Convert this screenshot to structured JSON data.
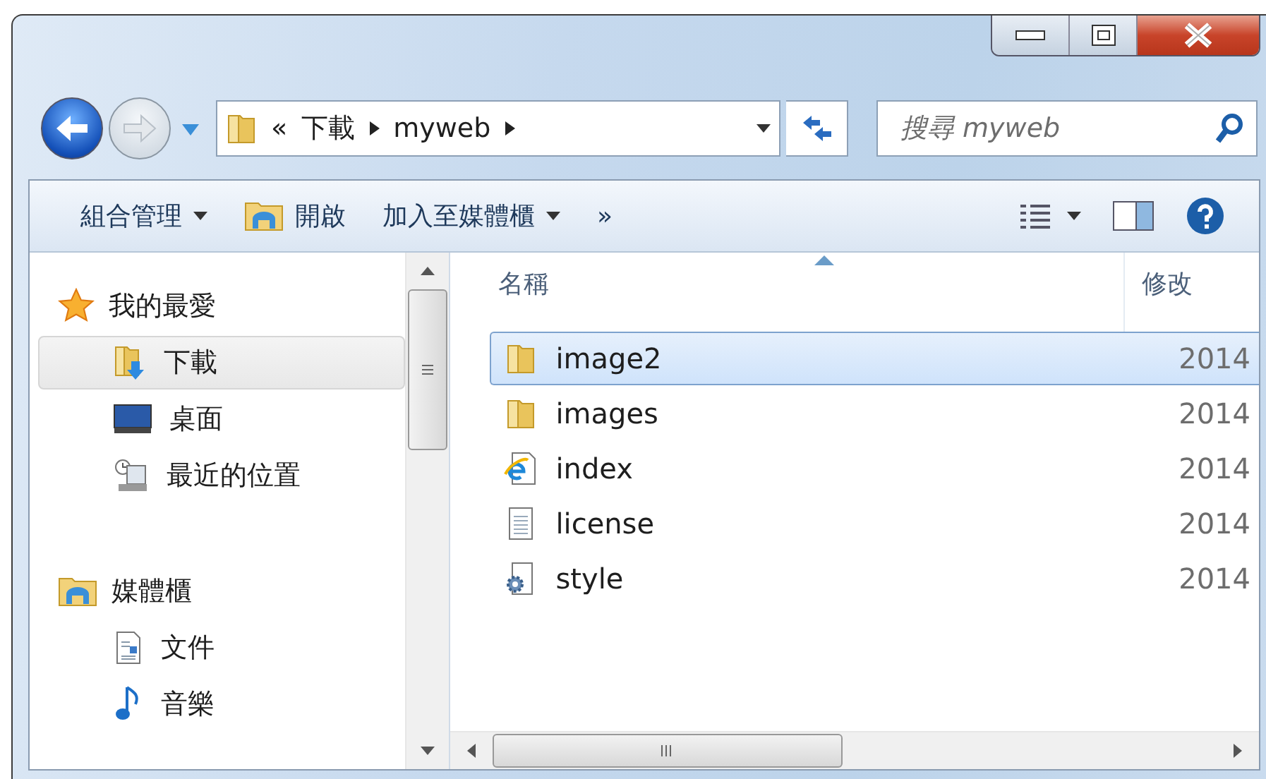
{
  "address_bar": {
    "overflow": "«",
    "crumbs": [
      "下載",
      "myweb"
    ]
  },
  "search": {
    "placeholder": "搜尋 myweb"
  },
  "toolbar": {
    "items": [
      {
        "kind": "menu",
        "label": "組合管理"
      },
      {
        "kind": "open",
        "label": "開啟"
      },
      {
        "kind": "menu",
        "label": "加入至媒體櫃"
      },
      {
        "kind": "more",
        "label": "»"
      }
    ]
  },
  "sidebar": {
    "groups": [
      {
        "label": "我的最愛",
        "children": [
          {
            "label": "下載",
            "selected": true
          },
          {
            "label": "桌面",
            "selected": false
          },
          {
            "label": "最近的位置",
            "selected": false
          }
        ]
      },
      {
        "label": "媒體櫃",
        "children": [
          {
            "label": "文件",
            "selected": false
          },
          {
            "label": "音樂",
            "selected": false
          }
        ]
      }
    ]
  },
  "file_list": {
    "columns": [
      "名稱",
      "修改"
    ],
    "rows": [
      {
        "name": "image2",
        "kind": "folder",
        "modified": "2014",
        "selected": true
      },
      {
        "name": "images",
        "kind": "folder",
        "modified": "2014",
        "selected": false
      },
      {
        "name": "index",
        "kind": "html",
        "modified": "2014",
        "selected": false
      },
      {
        "name": "license",
        "kind": "text",
        "modified": "2014",
        "selected": false
      },
      {
        "name": "style",
        "kind": "config",
        "modified": "2014",
        "selected": false
      }
    ]
  }
}
